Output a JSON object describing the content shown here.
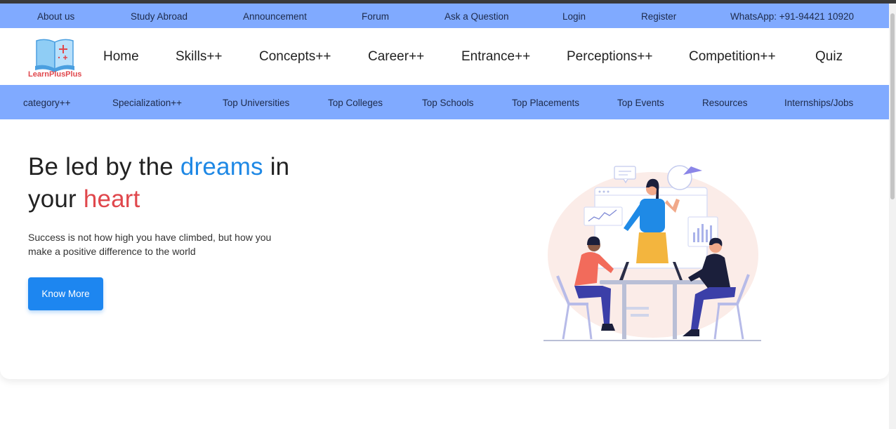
{
  "topbar": {
    "links": [
      "About us",
      "Study Abroad",
      "Announcement",
      "Forum",
      "Ask a Question",
      "Login",
      "Register",
      "WhatsApp: +91-94421 10920"
    ]
  },
  "logo": {
    "text": "LearnPlusPlus",
    "icon": "book-plus-icon"
  },
  "mainnav": {
    "items": [
      "Home",
      "Skills++",
      "Concepts++",
      "Career++",
      "Entrance++",
      "Perceptions++",
      "Competition++",
      "Quiz"
    ]
  },
  "subnav": {
    "items": [
      "category++",
      "Specialization++",
      "Top Universities",
      "Top Colleges",
      "Top Schools",
      "Top Placements",
      "Top Events",
      "Resources",
      "Internships/Jobs"
    ]
  },
  "hero": {
    "title_part1": "Be led by the ",
    "title_highlight1": "dreams",
    "title_part2": " in",
    "title_line2": "your ",
    "title_highlight2": "heart",
    "subtitle": "Success is not how high you have climbed, but how you make a positive difference to the world",
    "button_label": "Know More",
    "illustration": "team-meeting-illustration"
  },
  "colors": {
    "nav_bar": "#80aaff",
    "accent_blue": "#1e88e5",
    "accent_red": "#e0474c",
    "button": "#1d86f0"
  }
}
